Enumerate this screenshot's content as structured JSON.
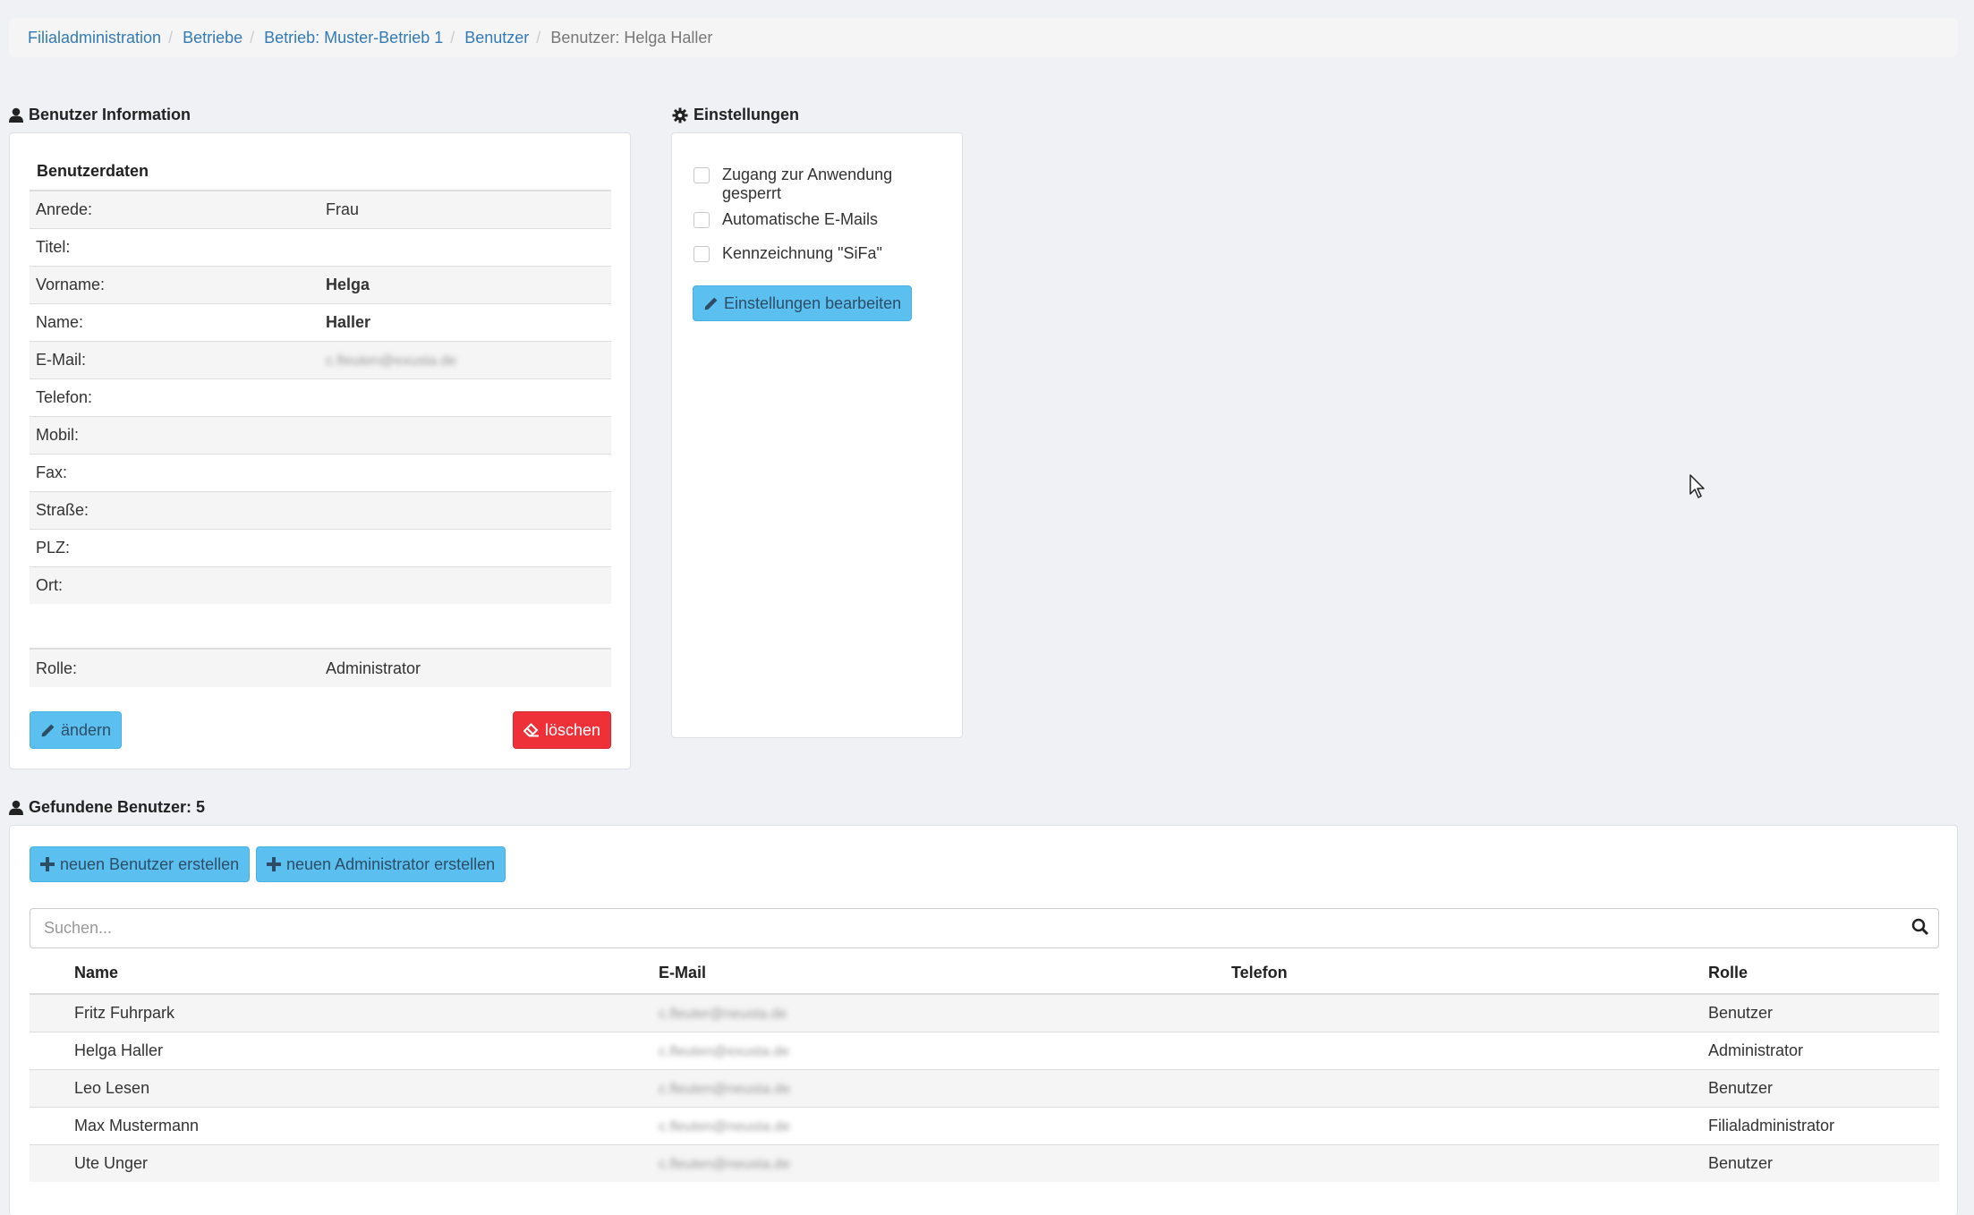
{
  "breadcrumb": {
    "items": [
      "Filialadministration",
      "Betriebe",
      "Betrieb: Muster-Betrieb 1",
      "Benutzer"
    ],
    "active": "Benutzer: Helga Haller"
  },
  "user_info": {
    "title": "Benutzer Information",
    "subtitle": "Benutzerdaten",
    "fields": [
      {
        "label": "Anrede:",
        "value": "Frau"
      },
      {
        "label": "Titel:",
        "value": ""
      },
      {
        "label": "Vorname:",
        "value": "Helga"
      },
      {
        "label": "Name:",
        "value": "Haller"
      },
      {
        "label": "E-Mail:",
        "value": "c.fleuten@exusta.de"
      },
      {
        "label": "Telefon:",
        "value": ""
      },
      {
        "label": "Mobil:",
        "value": ""
      },
      {
        "label": "Fax:",
        "value": ""
      },
      {
        "label": "Straße:",
        "value": ""
      },
      {
        "label": "PLZ:",
        "value": ""
      },
      {
        "label": "Ort:",
        "value": ""
      }
    ],
    "role_label": "Rolle:",
    "role_value": "Administrator",
    "edit_label": "ändern",
    "delete_label": "löschen"
  },
  "settings": {
    "title": "Einstellungen",
    "options": [
      {
        "label": "Zugang zur Anwendung gesperrt",
        "checked": false
      },
      {
        "label": "Automatische E-Mails",
        "checked": false
      },
      {
        "label": "Kennzeichnung \"SiFa\"",
        "checked": false
      }
    ],
    "edit_label": "Einstellungen bearbeiten"
  },
  "users": {
    "title": "Gefundene Benutzer: 5",
    "new_user_label": "neuen Benutzer erstellen",
    "new_admin_label": "neuen Administrator erstellen",
    "search_placeholder": "Suchen...",
    "columns": [
      "Name",
      "E-Mail",
      "Telefon",
      "Rolle"
    ],
    "rows": [
      {
        "name": "Fritz Fuhrpark",
        "email": "c.fleuter@neusta.de",
        "phone": "",
        "role": "Benutzer"
      },
      {
        "name": "Helga Haller",
        "email": "c.fleuten@exusta.de",
        "phone": "",
        "role": "Administrator"
      },
      {
        "name": "Leo Lesen",
        "email": "c.fleuten@neusta.de",
        "phone": "",
        "role": "Benutzer"
      },
      {
        "name": "Max Mustermann",
        "email": "c.fleuten@neusta.de",
        "phone": "",
        "role": "Filialadministrator"
      },
      {
        "name": "Ute Unger",
        "email": "c.fleuten@neusta.de",
        "phone": "",
        "role": "Benutzer"
      }
    ]
  },
  "colors": {
    "link": "#337ab7",
    "info_button": "#5bc0f0",
    "danger_button": "#ee3139",
    "background": "#eff1f5"
  }
}
